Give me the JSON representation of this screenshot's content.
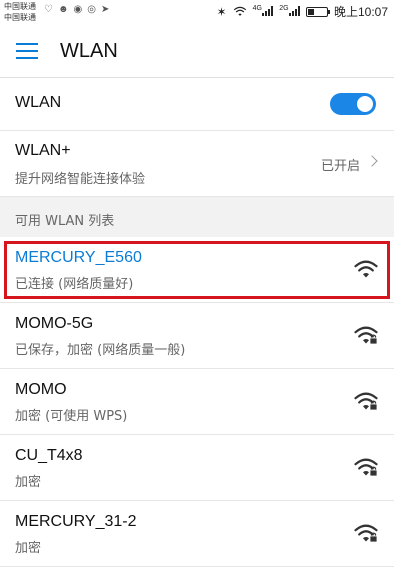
{
  "status_bar": {
    "carrier_1": "中国联通",
    "carrier_2": "中国联通",
    "sim1_type": "4G",
    "sim2_type": "2G",
    "time": "晚上10:07",
    "battery_level": 0.35
  },
  "appbar": {
    "title": "WLAN"
  },
  "wlan": {
    "label": "WLAN",
    "enabled": true
  },
  "wlan_plus": {
    "label": "WLAN+",
    "subtitle": "提升网络智能连接体验",
    "status": "已开启"
  },
  "section_header": "可用 WLAN 列表",
  "networks": [
    {
      "name": "MERCURY_E560",
      "status": "已连接 (网络质量好)",
      "connected": true,
      "locked": false
    },
    {
      "name": "MOMO-5G",
      "status": "已保存，加密 (网络质量一般)",
      "connected": false,
      "locked": true
    },
    {
      "name": "MOMO",
      "status": "加密 (可使用 WPS)",
      "connected": false,
      "locked": true
    },
    {
      "name": "CU_T4x8",
      "status": "加密",
      "connected": false,
      "locked": true
    },
    {
      "name": "MERCURY_31-2",
      "status": "加密",
      "connected": false,
      "locked": true
    }
  ],
  "colors": {
    "accent": "#0a7cd6",
    "toggle_on": "#1b86e6",
    "highlight_box": "#d7151d"
  }
}
